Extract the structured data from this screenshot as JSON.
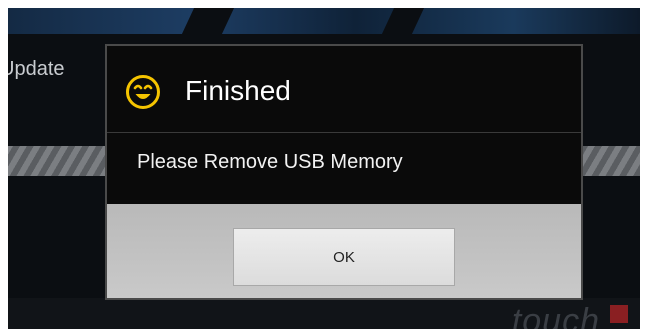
{
  "background": {
    "label": "Update",
    "brand_text": "touch"
  },
  "dialog": {
    "icon": "smiley-icon",
    "title": "Finished",
    "message": "Please Remove USB Memory",
    "ok_label": "OK"
  },
  "colors": {
    "icon_yellow": "#f5c400",
    "dialog_bg": "#0a0a0a",
    "button_area": "#c3c3c3",
    "hatch_light": "#7b7e82",
    "hatch_dark": "#5a5d61",
    "accent_red": "#8a1f22"
  }
}
